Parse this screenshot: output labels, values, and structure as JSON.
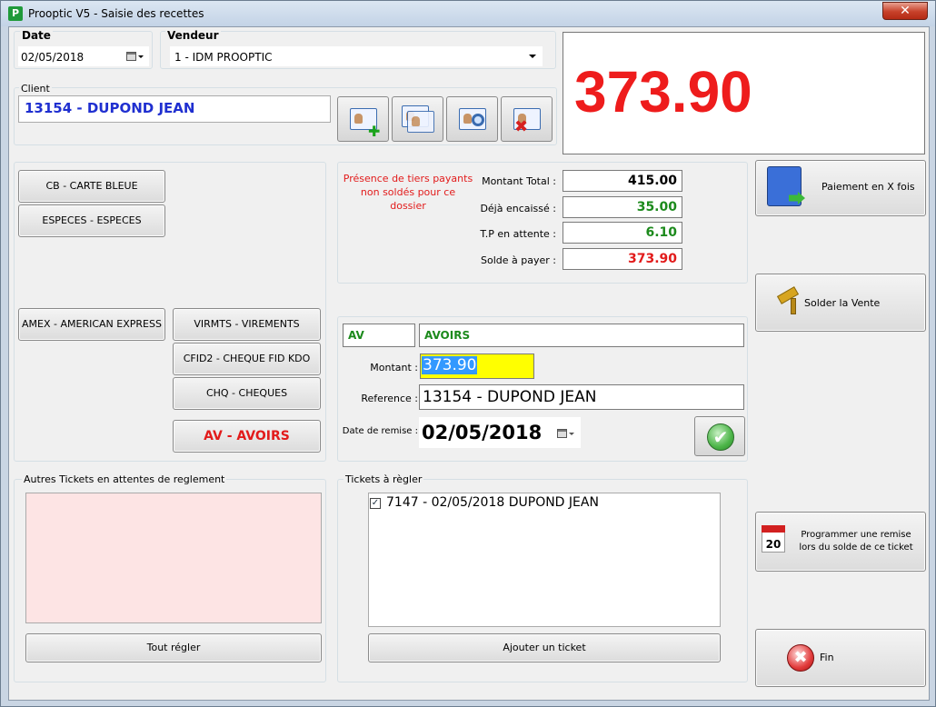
{
  "window": {
    "title": "Prooptic V5 - Saisie des recettes",
    "close_label": "✕",
    "app_icon_letter": "P"
  },
  "header": {
    "date_label": "Date",
    "date_value": "02/05/2018",
    "vendeur_label": "Vendeur",
    "vendeur_value": "1 - IDM PROOPTIC",
    "client_label": "Client",
    "client_value": "13154 - DUPOND JEAN",
    "amount_display": "373.90",
    "amount_color": "#ee1c1c"
  },
  "client_buttons": [
    {
      "icon": "add-client-icon"
    },
    {
      "icon": "client-list-icon"
    },
    {
      "icon": "search-client-icon"
    },
    {
      "icon": "remove-client-icon"
    }
  ],
  "payment_modes": {
    "cb": "CB - CARTE BLEUE",
    "especes": "ESPECES - ESPECES",
    "amex": "AMEX - AMERICAN EXPRESS",
    "virmts": "VIRMTS - VIREMENTS",
    "cfid2": "CFID2 - CHEQUE FID KDO",
    "chq": "CHQ - CHEQUES",
    "av": "AV - AVOIRS"
  },
  "summary": {
    "warning": "Présence de tiers payants non soldés pour ce dossier",
    "montant_total_label": "Montant Total :",
    "montant_total": "415.00",
    "deja_encaisse_label": "Déjà encaissé :",
    "deja_encaisse": "35.00",
    "tp_attente_label": "T.P en attente :",
    "tp_attente": "6.10",
    "solde_label": "Solde à payer :",
    "solde": "373.90"
  },
  "entry": {
    "code": "AV",
    "name": "AVOIRS",
    "montant_label": "Montant :",
    "montant_value": "373.90",
    "reference_label": "Reference :",
    "reference_value": "13154 - DUPOND JEAN",
    "date_remise_label": "Date de remise :",
    "date_remise_value": "02/05/2018"
  },
  "actions": {
    "paiement_x_fois": "Paiement en X fois",
    "solder_vente": "Solder la Vente",
    "programmer_remise": "Programmer une remise lors du solde de ce ticket",
    "fin": "Fin"
  },
  "autres_tickets": {
    "title": "Autres Tickets en attentes de reglement",
    "button": "Tout régler",
    "bg_color": "#fde4e4"
  },
  "tickets_regler": {
    "title": "Tickets à règler",
    "items": [
      {
        "label": "7147 - 02/05/2018 DUPOND JEAN",
        "checked": true
      }
    ],
    "button": "Ajouter un ticket"
  }
}
